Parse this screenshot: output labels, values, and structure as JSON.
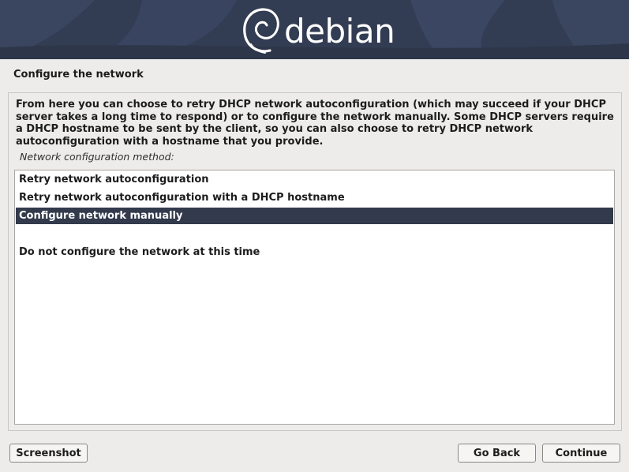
{
  "banner": {
    "brand": "debian",
    "colors": {
      "background": "#323c52",
      "highlight": "#4a5672"
    },
    "logo_icon": "debian-swirl-icon"
  },
  "page": {
    "title": "Configure the network"
  },
  "description": "From here you can choose to retry DHCP network autoconfiguration (which may succeed if your DHCP server takes a long time to respond) or to configure the network manually. Some DHCP servers require a DHCP hostname to be sent by the client, so you can also choose to retry DHCP network autoconfiguration with a hostname that you provide.",
  "question": "Network configuration method:",
  "options": [
    {
      "label": "Retry network autoconfiguration",
      "selected": false
    },
    {
      "label": "Retry network autoconfiguration with a DHCP hostname",
      "selected": false
    },
    {
      "label": "Configure network manually",
      "selected": true
    },
    {
      "label": "",
      "selected": false
    },
    {
      "label": "Do not configure the network at this time",
      "selected": false
    }
  ],
  "buttons": {
    "screenshot": "Screenshot",
    "go_back": "Go Back",
    "continue": "Continue"
  },
  "colors": {
    "selection": "#323a4c",
    "window_bg": "#edeceb"
  }
}
